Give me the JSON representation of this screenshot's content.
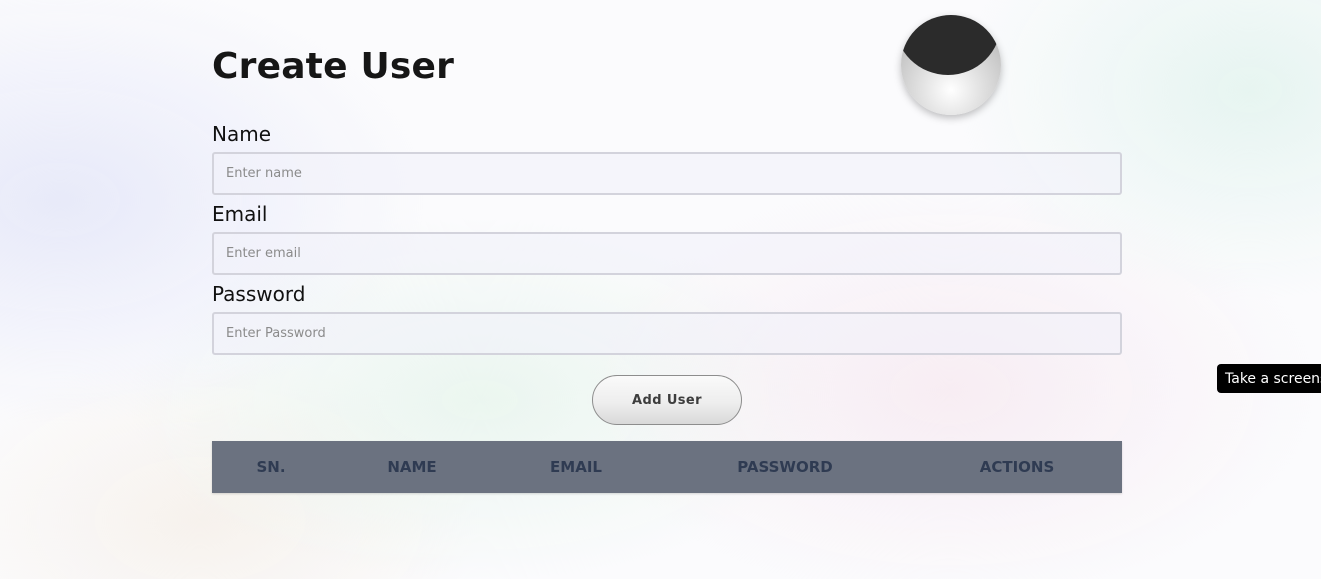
{
  "page": {
    "title": "Create User"
  },
  "form": {
    "name_label": "Name",
    "name_placeholder": "Enter name",
    "email_label": "Email",
    "email_placeholder": "Enter email",
    "password_label": "Password",
    "password_placeholder": "Enter Password",
    "submit_label": "Add User"
  },
  "table": {
    "headers": [
      "SN.",
      "NAME",
      "EMAIL",
      "PASSWORD",
      "ACTIONS"
    ]
  },
  "tooltip": {
    "text": "Take a screenshot"
  },
  "colors": {
    "table_header_bg": "#6b7280",
    "table_header_text": "#2f3b52",
    "tooltip_bg": "#000000"
  }
}
